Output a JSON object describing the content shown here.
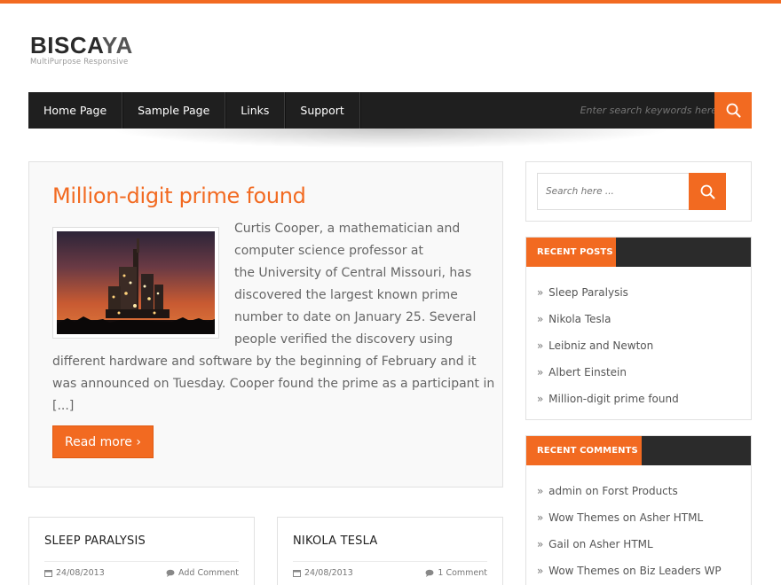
{
  "site": {
    "title_main": "BISCA",
    "title_accent": "YA",
    "tagline": "MultiPurpose Responsive"
  },
  "nav": {
    "items": [
      {
        "label": "Home Page"
      },
      {
        "label": "Sample Page"
      },
      {
        "label": "Links"
      },
      {
        "label": "Support"
      }
    ],
    "search_placeholder": "Enter search keywords here ..."
  },
  "colors": {
    "accent": "#f26a21",
    "dark": "#1f1f1f"
  },
  "featured_post": {
    "title": "Million-digit prime found",
    "excerpt_lines": [
      "Curtis Cooper, a mathematician and",
      "computer science professor at",
      "the University of Central Missouri, has",
      "discovered the largest known prime",
      "number to date on January 25. Several",
      "people verified the discovery using",
      "different hardware and software by the beginning of February and it",
      "was announced on Tuesday. Cooper found the prime as a participant in",
      "[...]"
    ],
    "read_more": "Read more ›"
  },
  "cards": [
    {
      "title": "SLEEP PARALYSIS",
      "date": "24/08/2013",
      "comments": "Add Comment"
    },
    {
      "title": "NIKOLA TESLA",
      "date": "24/08/2013",
      "comments": "1 Comment"
    }
  ],
  "sidebar": {
    "search_placeholder": "Search here ...",
    "recent_posts": {
      "heading": "RECENT POSTS",
      "items": [
        "Sleep Paralysis",
        "Nikola Tesla",
        "Leibniz and Newton",
        "Albert Einstein",
        "Million-digit prime found"
      ]
    },
    "recent_comments": {
      "heading": "RECENT COMMENTS",
      "items": [
        {
          "author": "admin",
          "on": "on",
          "post": "Forst Products"
        },
        {
          "author": "Wow Themes",
          "on": "on",
          "post": "Asher HTML"
        },
        {
          "author": "Gail",
          "on": "on",
          "post": "Asher HTML"
        },
        {
          "author": "Wow Themes",
          "on": "on",
          "post": "Biz Leaders WP"
        }
      ]
    }
  }
}
